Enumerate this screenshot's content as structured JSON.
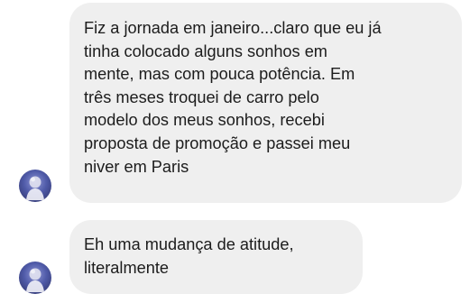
{
  "messages": [
    {
      "sender": "received",
      "lines": [
        "Fiz a jornada em janeiro...claro que eu já",
        "tinha colocado alguns sonhos em",
        "mente, mas com pouca potência. Em",
        "três meses troquei de carro pelo",
        "modelo dos meus sonhos, recebi",
        "proposta de promoção e passei meu",
        "niver em Paris"
      ]
    },
    {
      "sender": "received",
      "lines": [
        "Eh uma mudança de atitude,",
        "literalmente"
      ]
    }
  ],
  "avatar_icon": "profile-photo-icon",
  "colors": {
    "bubble": "#efefef",
    "text": "#1c1c1c",
    "background": "#ffffff"
  }
}
